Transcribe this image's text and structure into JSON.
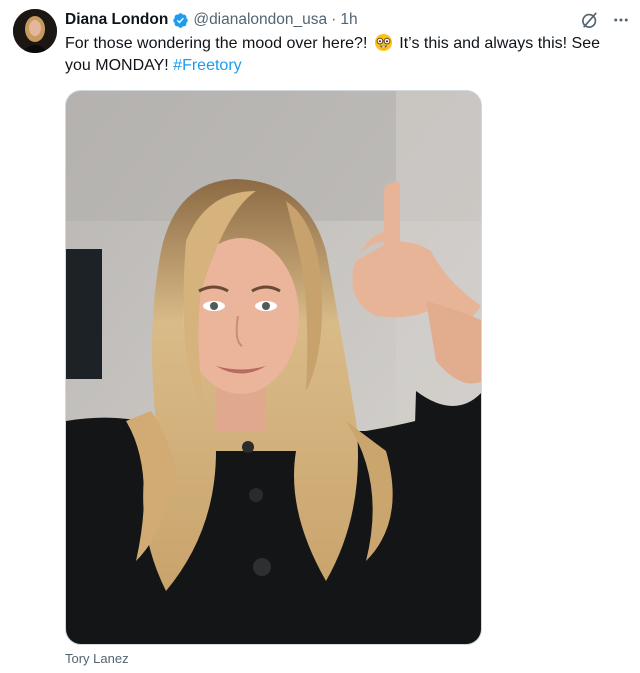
{
  "tweet": {
    "author_name": "Diana London",
    "author_handle": "@dianalondon_usa",
    "separator": "·",
    "timestamp": "1h",
    "text_part1": "For those wondering the mood over here?! ",
    "emoji": "nerd-face-emoji",
    "text_part2": " It’s this and always this! See you MONDAY! ",
    "hashtag": "#Freetory",
    "media_alt": "Woman with long wavy blonde hair in a black button cardigan giving a thumbs up",
    "tagged_user": "Tory Lanez"
  },
  "icons": {
    "verified": "verified-badge-icon",
    "grok": "grok-icon",
    "more": "more-options-icon"
  },
  "colors": {
    "accent": "#1d9bf0",
    "secondary_text": "#536471",
    "primary_text": "#0f1419"
  }
}
